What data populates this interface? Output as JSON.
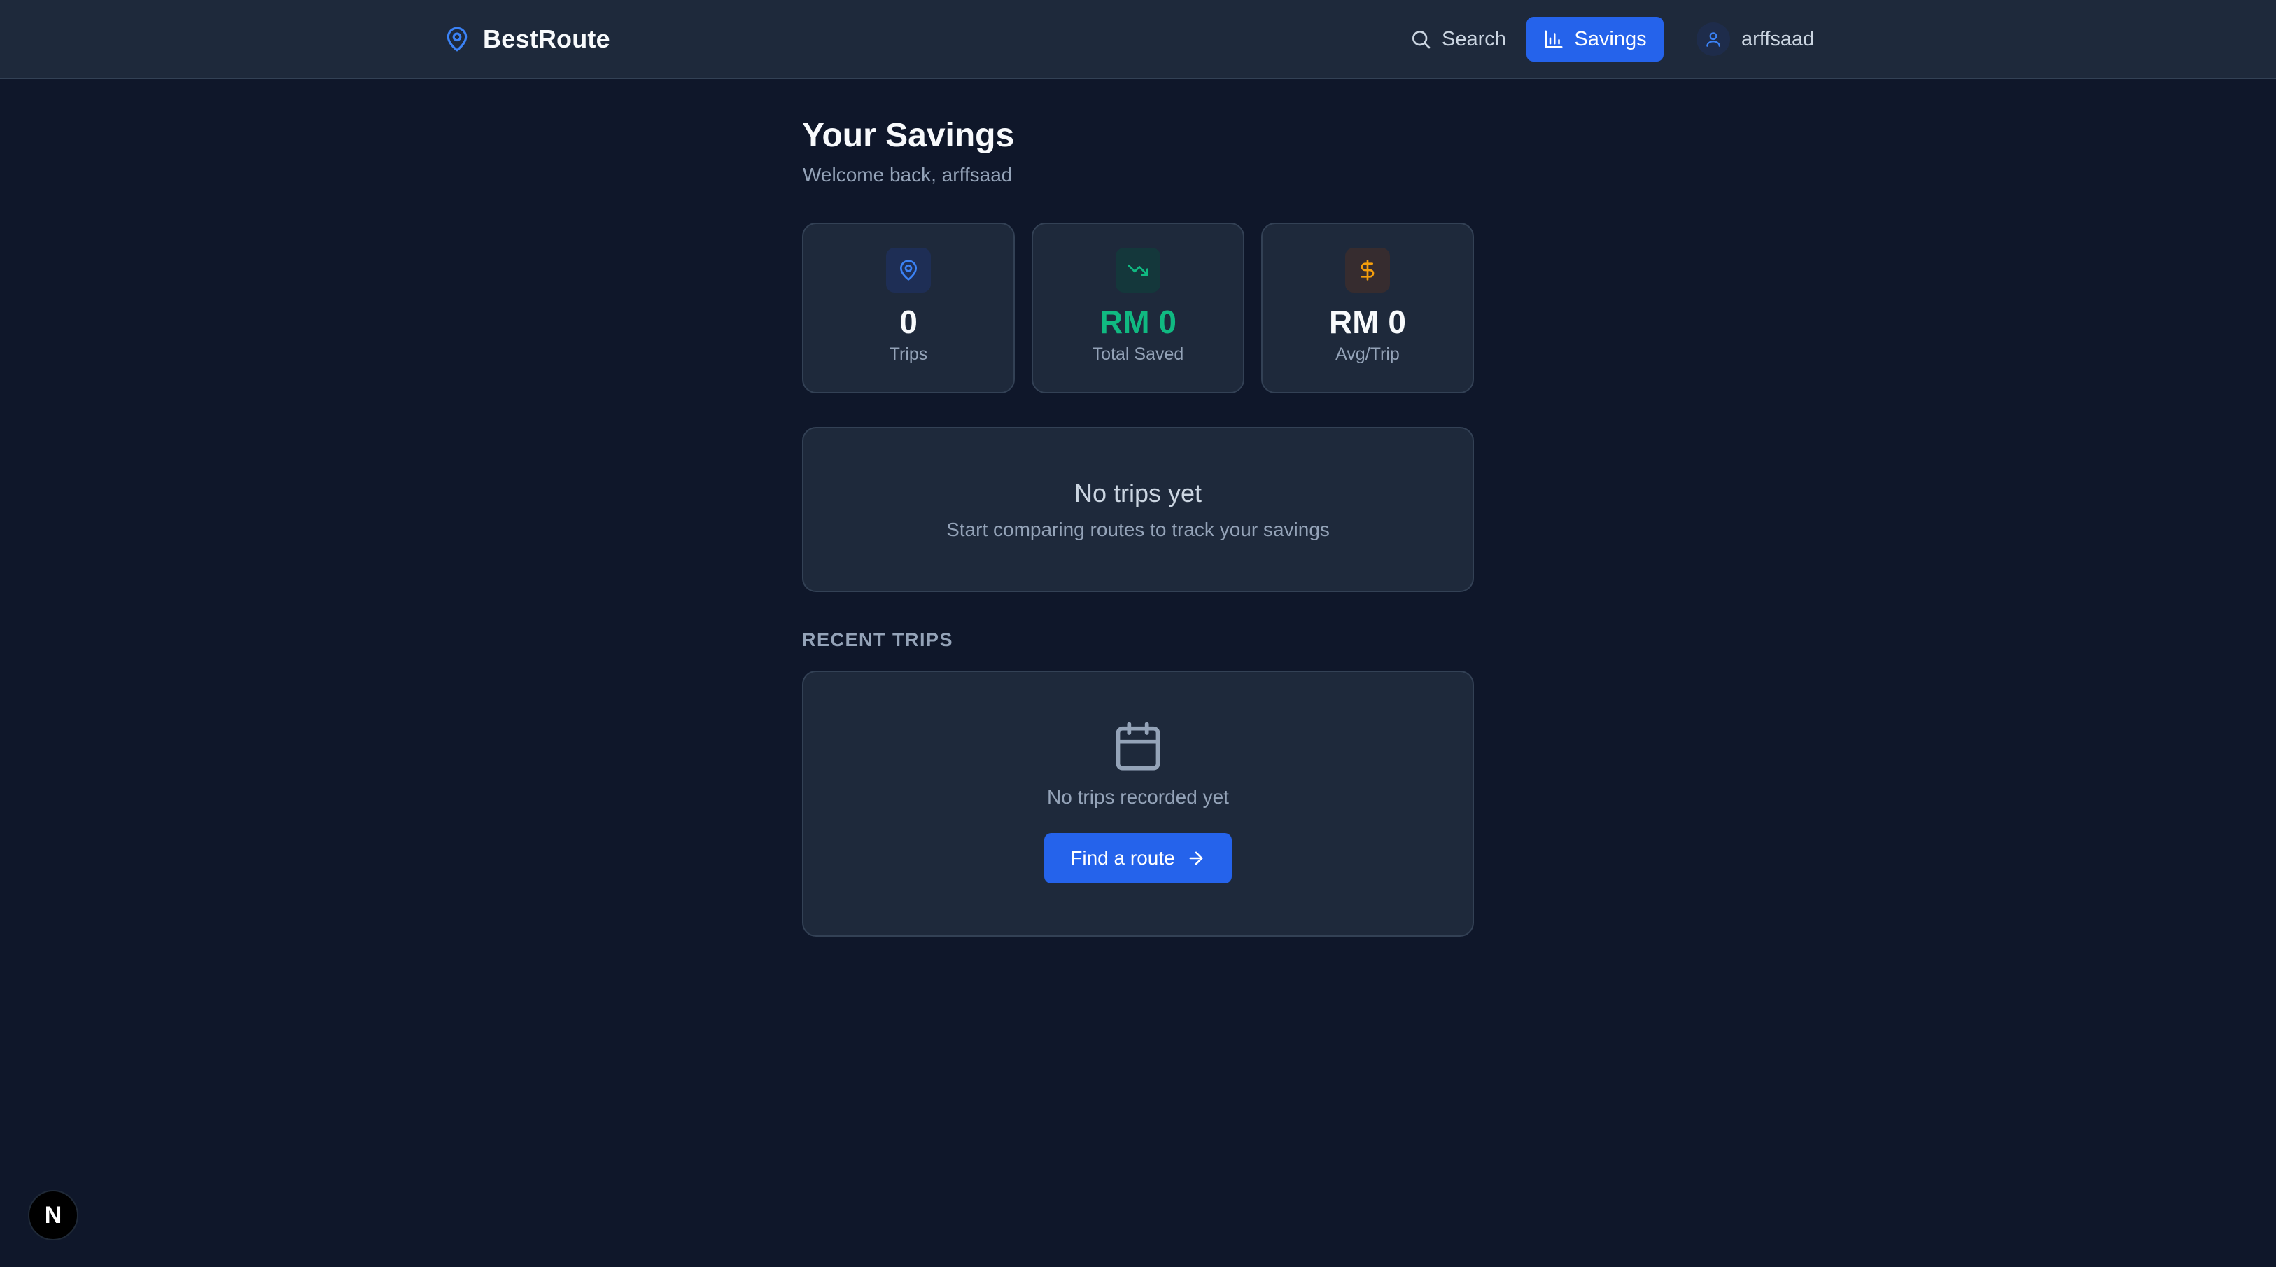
{
  "colors": {
    "background": "#0f172a",
    "surface": "#1e293b",
    "border": "#334155",
    "accent": "#2563eb",
    "success": "#10b981",
    "warning": "#f59e0b"
  },
  "header": {
    "brand": "BestRoute",
    "brand_icon": "map-pin-icon",
    "nav": {
      "search_label": "Search",
      "savings_label": "Savings",
      "active": "Savings"
    },
    "user": {
      "name": "arffsaad",
      "icon": "user-icon"
    }
  },
  "page": {
    "title": "Your Savings",
    "subtitle": "Welcome back, arffsaad"
  },
  "stats": [
    {
      "icon": "map-pin-icon",
      "value": "0",
      "label": "Trips",
      "color": "#3b82f6"
    },
    {
      "icon": "trending-down-icon",
      "value": "RM 0",
      "label": "Total Saved",
      "color": "#10b981"
    },
    {
      "icon": "dollar-icon",
      "value": "RM 0",
      "label": "Avg/Trip",
      "color": "#f59e0b"
    }
  ],
  "summary": {
    "title": "No trips yet",
    "text": "Start comparing routes to track your savings"
  },
  "recent": {
    "heading": "RECENT TRIPS",
    "empty_icon": "calendar-icon",
    "empty_text": "No trips recorded yet",
    "button_label": "Find a route"
  },
  "badge": {
    "letter": "N"
  }
}
